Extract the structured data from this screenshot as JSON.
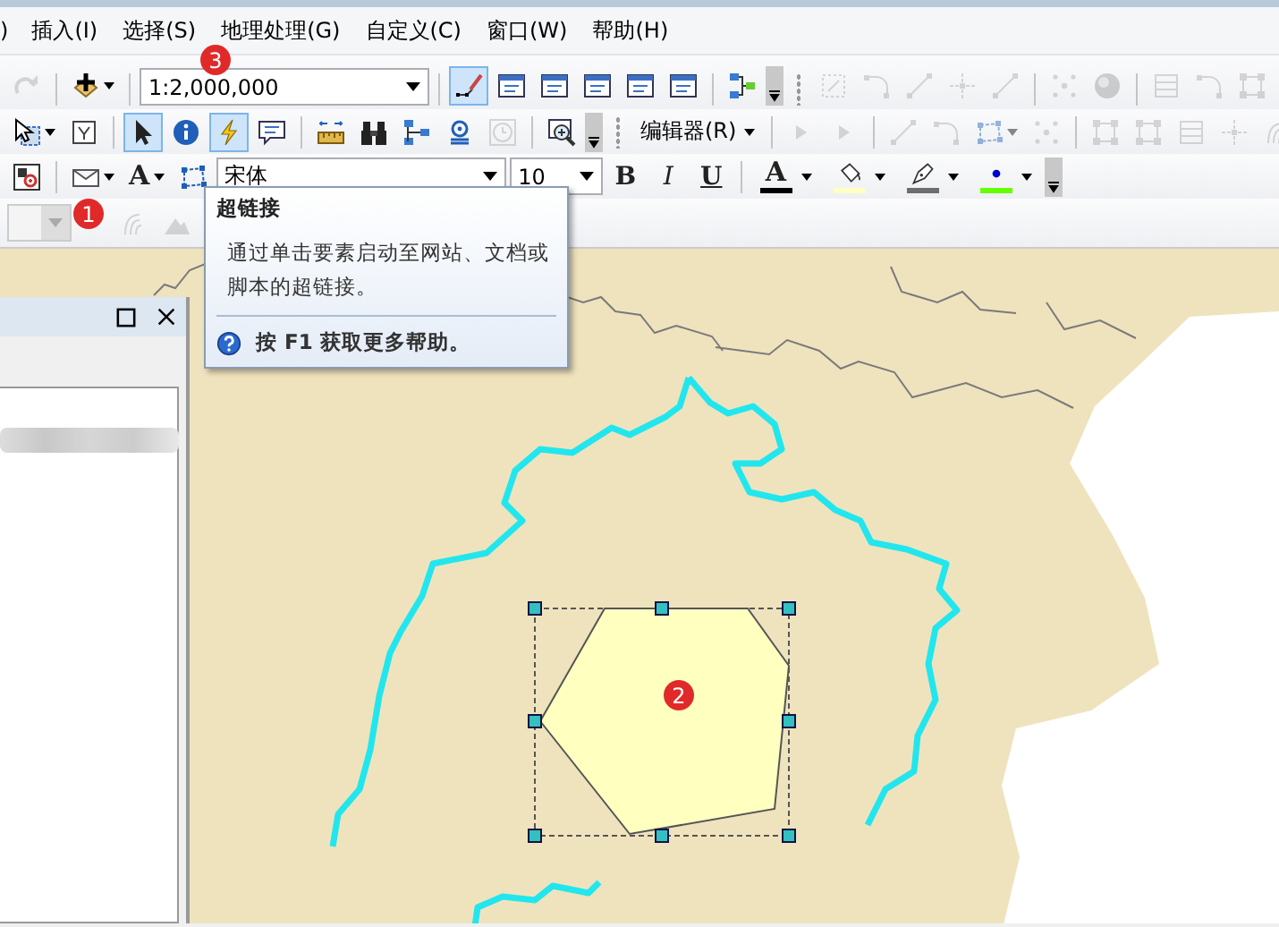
{
  "menu": [
    {
      "label": ")"
    },
    {
      "label": "插入(I)"
    },
    {
      "label": "选择(S)"
    },
    {
      "label": "地理处理(G)"
    },
    {
      "label": "自定义(C)"
    },
    {
      "label": "窗口(W)"
    },
    {
      "label": "帮助(H)"
    }
  ],
  "toolbars": [
    {
      "items": [
        {
          "kind": "tool",
          "selected": false,
          "disabled": true
        },
        {
          "kind": "sep"
        },
        {
          "kind": "tool",
          "selected": false,
          "disabled": false,
          "dropdown": true
        },
        {
          "kind": "sep"
        },
        {
          "kind": "combo",
          "value": "1:2,000,000"
        },
        {
          "kind": "sep"
        },
        {
          "kind": "tool",
          "selected": true,
          "disabled": false
        },
        {
          "kind": "tool",
          "selected": false,
          "disabled": false
        },
        {
          "kind": "tool",
          "selected": false,
          "disabled": false
        },
        {
          "kind": "tool",
          "selected": false,
          "disabled": false
        },
        {
          "kind": "tool",
          "selected": false,
          "disabled": false
        },
        {
          "kind": "tool",
          "selected": false,
          "disabled": false
        },
        {
          "kind": "sep"
        },
        {
          "kind": "tool",
          "selected": false,
          "disabled": false
        },
        {
          "kind": "overflow"
        },
        {
          "kind": "grip"
        },
        {
          "kind": "tool",
          "selected": false,
          "disabled": true
        },
        {
          "kind": "tool",
          "selected": false,
          "disabled": true
        },
        {
          "kind": "tool",
          "selected": false,
          "disabled": true
        },
        {
          "kind": "tool",
          "selected": false,
          "disabled": true
        },
        {
          "kind": "tool",
          "selected": false,
          "disabled": true
        },
        {
          "kind": "sep"
        },
        {
          "kind": "tool",
          "selected": false,
          "disabled": true
        },
        {
          "kind": "tool",
          "selected": false,
          "disabled": true
        },
        {
          "kind": "sep"
        },
        {
          "kind": "tool",
          "selected": false,
          "disabled": true
        },
        {
          "kind": "tool",
          "selected": false,
          "disabled": true
        },
        {
          "kind": "tool",
          "selected": false,
          "disabled": true
        }
      ]
    },
    {
      "items": [
        {
          "kind": "tool",
          "selected": false,
          "disabled": false,
          "dropdown": true
        },
        {
          "kind": "tool",
          "selected": false,
          "disabled": false
        },
        {
          "kind": "sep"
        },
        {
          "kind": "tool",
          "selected": true,
          "disabled": false
        },
        {
          "kind": "tool",
          "selected": false,
          "disabled": false
        },
        {
          "kind": "tool",
          "selected": true,
          "disabled": false
        },
        {
          "kind": "tool",
          "selected": false,
          "disabled": false
        },
        {
          "kind": "sep"
        },
        {
          "kind": "tool",
          "selected": false,
          "disabled": false
        },
        {
          "kind": "tool",
          "selected": false,
          "disabled": false
        },
        {
          "kind": "tool",
          "selected": false,
          "disabled": false
        },
        {
          "kind": "tool",
          "selected": false,
          "disabled": false
        },
        {
          "kind": "tool",
          "selected": false,
          "disabled": true
        },
        {
          "kind": "sep"
        },
        {
          "kind": "tool",
          "selected": false,
          "disabled": false
        },
        {
          "kind": "overflow"
        },
        {
          "kind": "grip"
        },
        {
          "kind": "menu",
          "label": "编辑器(R)"
        },
        {
          "kind": "sep"
        },
        {
          "kind": "tool",
          "selected": false,
          "disabled": true
        },
        {
          "kind": "tool",
          "selected": false,
          "disabled": true
        },
        {
          "kind": "sep"
        },
        {
          "kind": "tool",
          "selected": false,
          "disabled": true
        },
        {
          "kind": "tool",
          "selected": false,
          "disabled": true
        },
        {
          "kind": "tool",
          "selected": false,
          "disabled": true,
          "dropdown": true
        },
        {
          "kind": "tool",
          "selected": false,
          "disabled": true
        },
        {
          "kind": "sep"
        },
        {
          "kind": "tool",
          "selected": false,
          "disabled": true
        },
        {
          "kind": "tool",
          "selected": false,
          "disabled": true
        },
        {
          "kind": "tool",
          "selected": false,
          "disabled": true
        },
        {
          "kind": "tool",
          "selected": false,
          "disabled": true
        },
        {
          "kind": "tool",
          "selected": false,
          "disabled": true
        }
      ]
    },
    {
      "items": [
        {
          "kind": "tool",
          "selected": false,
          "disabled": false
        },
        {
          "kind": "sep"
        },
        {
          "kind": "tool",
          "selected": false,
          "disabled": false,
          "dropdown": true
        },
        {
          "kind": "text-tool",
          "label": "A",
          "dropdown": true
        },
        {
          "kind": "tool",
          "selected": false,
          "disabled": false
        },
        {
          "kind": "combo",
          "value": "宋体"
        },
        {
          "kind": "combo",
          "value": "10"
        },
        {
          "kind": "format",
          "label": "B"
        },
        {
          "kind": "format",
          "label": "I"
        },
        {
          "kind": "format",
          "label": "U"
        },
        {
          "kind": "sep"
        },
        {
          "kind": "color-tool",
          "label": "A",
          "color": "#000000"
        },
        {
          "kind": "color-tool",
          "color": "#ffffc0"
        },
        {
          "kind": "color-tool",
          "color": "#6e6e6e"
        },
        {
          "kind": "color-tool",
          "color": "#66ff00"
        },
        {
          "kind": "overflow"
        }
      ]
    },
    {
      "items": [
        {
          "kind": "combo",
          "disabled": true
        },
        {
          "kind": "tool",
          "selected": false,
          "disabled": true
        },
        {
          "kind": "tool",
          "selected": false,
          "disabled": true
        }
      ]
    }
  ],
  "tooltip": {
    "title": "超链接",
    "text": "通过单击要素启动至网站、文档或脚本的超链接。",
    "help": "按 **F1** 获取更多帮助。"
  },
  "badges": [
    {
      "label": "3"
    },
    {
      "label": "1"
    },
    {
      "label": "2"
    }
  ]
}
